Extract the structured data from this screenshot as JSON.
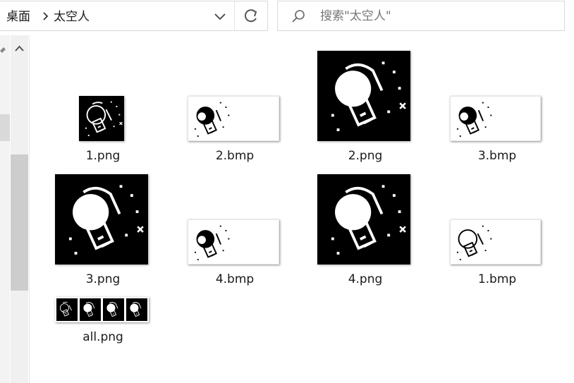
{
  "breadcrumb": {
    "items": [
      "桌面",
      "太空人"
    ]
  },
  "search": {
    "placeholder": "搜索\"太空人\""
  },
  "files": [
    {
      "name": "1.png",
      "kind": "png"
    },
    {
      "name": "2.bmp",
      "kind": "bmp"
    },
    {
      "name": "2.png",
      "kind": "png"
    },
    {
      "name": "3.bmp",
      "kind": "bmp"
    },
    {
      "name": "3.png",
      "kind": "png"
    },
    {
      "name": "4.bmp",
      "kind": "bmp"
    },
    {
      "name": "4.png",
      "kind": "png"
    },
    {
      "name": "1.bmp",
      "kind": "bmp"
    },
    {
      "name": "all.png",
      "kind": "png"
    }
  ],
  "icons": {
    "chevron": "chevron-right-icon",
    "dropdown": "chevron-down-icon",
    "refresh": "refresh-icon",
    "search": "search-icon",
    "pin": "pin-icon",
    "scroll_up": "scroll-up-icon"
  },
  "colors": {
    "window_bg": "#ffffff",
    "border": "#d9d9d9",
    "muted_text": "#767676",
    "scroll_thumb": "#cdcdcd"
  }
}
